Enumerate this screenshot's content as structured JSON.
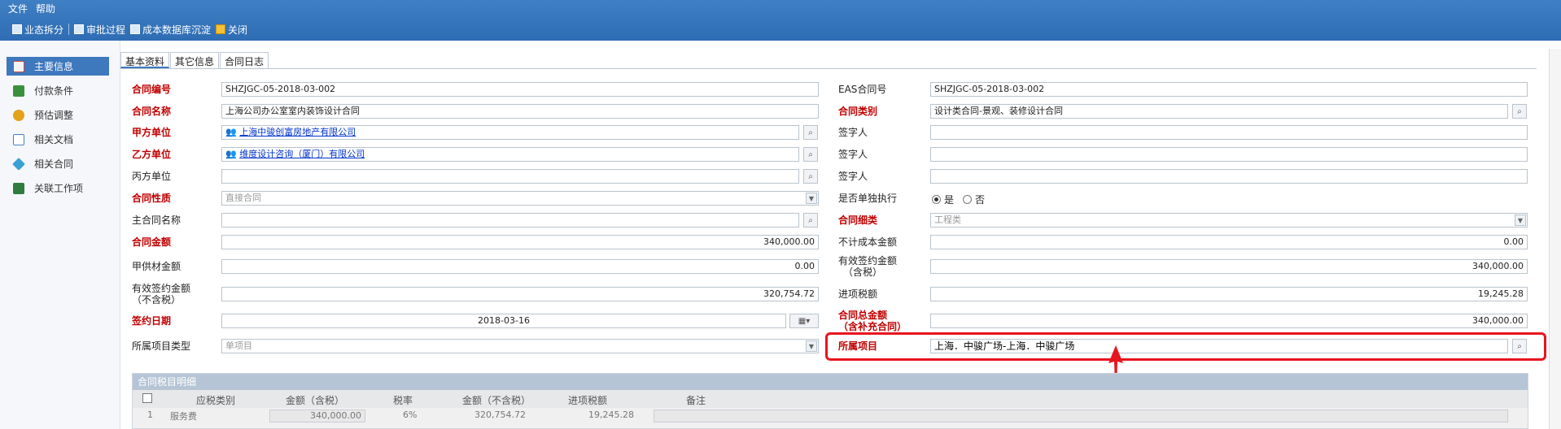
{
  "menu": [
    "文件",
    "帮助"
  ],
  "toolbar": [
    {
      "label": "业态拆分",
      "icon": "split-icon"
    },
    {
      "label": "审批过程",
      "icon": "approval-icon"
    },
    {
      "label": "成本数据库沉淀",
      "icon": "database-icon"
    },
    {
      "label": "关闭",
      "icon": "close-icon"
    }
  ],
  "sidebar": [
    {
      "label": "主要信息",
      "active": true,
      "color": "#d64a3b"
    },
    {
      "label": "付款条件",
      "active": false,
      "color": "#3c8f3c"
    },
    {
      "label": "预估调整",
      "active": false,
      "color": "#e3a21a"
    },
    {
      "label": "相关文档",
      "active": false,
      "color": "#4a7fc1"
    },
    {
      "label": "相关合同",
      "active": false,
      "color": "#39a0d6"
    },
    {
      "label": "关联工作项",
      "active": false,
      "color": "#2f7c3e"
    }
  ],
  "tabs": [
    "基本资料",
    "其它信息",
    "合同日志"
  ],
  "form": {
    "contract_no_label": "合同编号",
    "contract_no": "SHZJGC-05-2018-03-002",
    "eas_no_label": "EAS合同号",
    "eas_no": "SHZJGC-05-2018-03-002",
    "contract_name_label": "合同名称",
    "contract_name": "上海公司办公室室内装饰设计合同",
    "contract_category_label": "合同类别",
    "contract_category": "设计类合同-景观、装修设计合同",
    "party_a_label": "甲方单位",
    "party_a": "上海中骏创富房地产有限公司",
    "signer1_label": "签字人",
    "signer1": "",
    "party_b_label": "乙方单位",
    "party_b": "维度设计咨询（厦门）有限公司",
    "signer2_label": "签字人",
    "signer2": "",
    "party_c_label": "丙方单位",
    "party_c": "",
    "signer3_label": "签字人",
    "signer3": "",
    "nature_label": "合同性质",
    "nature": "直接合同",
    "separate_label": "是否单独执行",
    "yes": "是",
    "no": "否",
    "main_contract_label": "主合同名称",
    "main_contract": "",
    "subtype_label": "合同细类",
    "subtype": "工程类",
    "amount_label": "合同金额",
    "amount": "340,000.00",
    "noncost_label": "不计成本金额",
    "noncost": "0.00",
    "supply_label": "甲供材金额",
    "supply": "0.00",
    "eff_tax_label_1": "有效签约金额",
    "eff_tax_label_2": "（含税）",
    "eff_tax": "340,000.00",
    "eff_notax_label_1": "有效签约金额",
    "eff_notax_label_2": "（不含税）",
    "eff_notax": "320,754.72",
    "input_tax_label": "进项税额",
    "input_tax": "19,245.28",
    "sign_date_label": "签约日期",
    "sign_date": "2018-03-16",
    "total_label_1": "合同总金额",
    "total_label_2": "（含补充合同）",
    "total": "340,000.00",
    "proj_type_label": "所属项目类型",
    "proj_type": "单项目",
    "project_label": "所属项目",
    "project": "上海．中骏广场-上海．中骏广场"
  },
  "detail": {
    "title": "合同税目明细",
    "columns": [
      "应税类别",
      "金额（含税）",
      "税率",
      "金额（不含税）",
      "进项税额",
      "备注"
    ],
    "rows": [
      {
        "no": "1",
        "type": "服务费",
        "amount_tax": "340,000.00",
        "rate": "6%",
        "amount_notax": "320,754.72",
        "tax": "19,245.28",
        "remark": ""
      }
    ]
  },
  "colors": {
    "highlight": "#e8141e",
    "header": "#2e6db3",
    "required": "#c00000"
  }
}
